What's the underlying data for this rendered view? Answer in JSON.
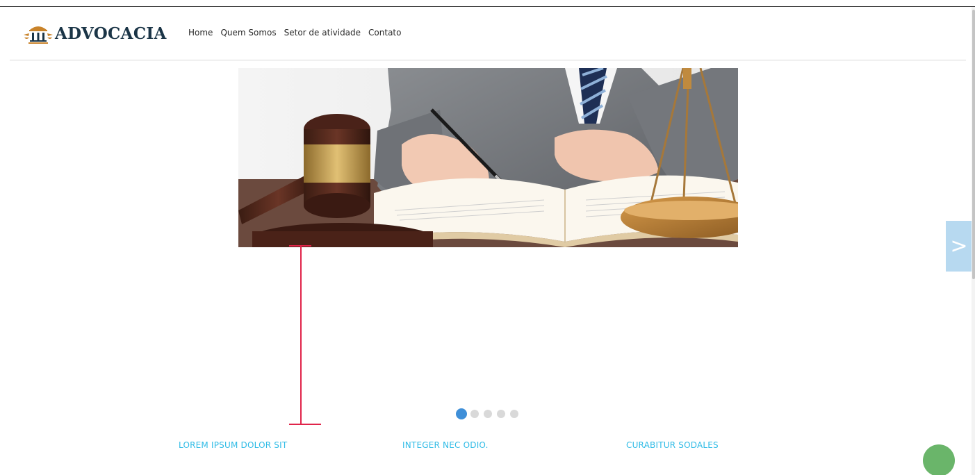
{
  "brand": {
    "name": "ADVOCACIA",
    "logo_icon": "columns-scales-icon",
    "colors": {
      "text": "#1b3547",
      "accent": "#c9832a"
    }
  },
  "nav": {
    "items": [
      {
        "label": "Home"
      },
      {
        "label": "Quem Somos"
      },
      {
        "label": "Setor de atividade"
      },
      {
        "label": "Contato"
      }
    ]
  },
  "slider": {
    "image_icon": "gavel-scales-book-photo",
    "next_label": ">",
    "dot_count": 5,
    "active_dot": 1,
    "colors": {
      "active_dot": "#3f8fd8",
      "inactive_dot": "#d9d9d9",
      "arrow_bg": "#b7d9f0"
    }
  },
  "features": [
    {
      "title": "LOREM IPSUM DOLOR SIT"
    },
    {
      "title": "INTEGER NEC ODIO."
    },
    {
      "title": "CURABITUR SODALES"
    }
  ],
  "colors": {
    "feature_title": "#2ebbe6",
    "cursor": "#e0244a",
    "floating_button": "#6ab56a"
  }
}
